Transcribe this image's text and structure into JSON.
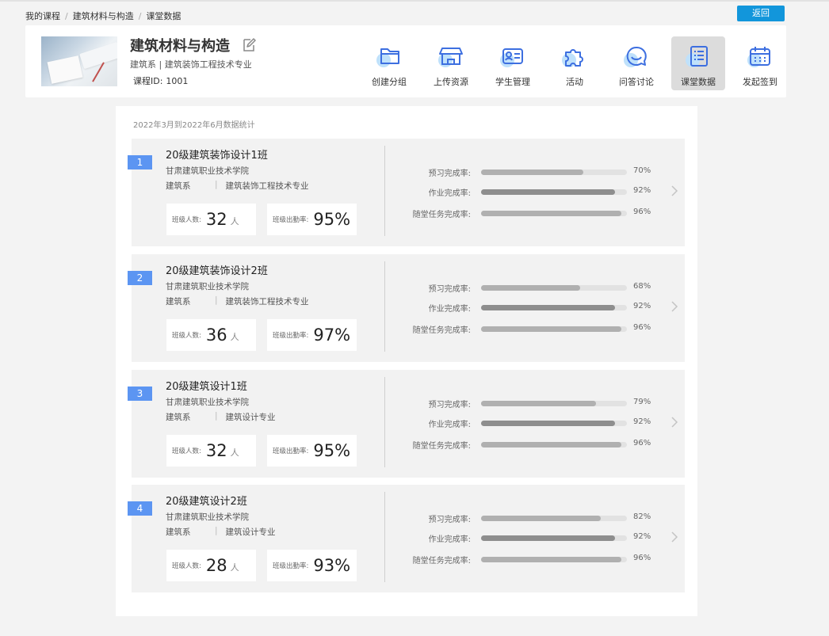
{
  "breadcrumb": {
    "items": [
      "我的课程",
      "建筑材料与构造",
      "课堂数据"
    ],
    "separator": "/"
  },
  "back_button": "返回",
  "course": {
    "title": "建筑材料与构造",
    "dept": "建筑系 | 建筑装饰工程技术专业",
    "id_label": "课程ID:",
    "id_value": "1001"
  },
  "toolbar": {
    "items": [
      {
        "label": "创建分组",
        "icon": "folder-icon"
      },
      {
        "label": "上传资源",
        "icon": "store-icon"
      },
      {
        "label": "学生管理",
        "icon": "id-card-icon"
      },
      {
        "label": "活动",
        "icon": "puzzle-icon"
      },
      {
        "label": "问答讨论",
        "icon": "chat-icon"
      },
      {
        "label": "课堂数据",
        "icon": "document-list-icon",
        "active": true
      },
      {
        "label": "发起签到",
        "icon": "calendar-icon"
      }
    ]
  },
  "period": "2022年3月到2022年6月数据统计",
  "labels": {
    "count": "班级人数:",
    "count_unit": "人",
    "attendance": "班级出勤率:",
    "preview": "预习完成率:",
    "homework": "作业完成率:",
    "task": "随堂任务完成率:"
  },
  "classes": [
    {
      "num": "1",
      "name": "20级建筑装饰设计1班",
      "school": "甘肃建筑职业技术学院",
      "dept": "建筑系",
      "major": "建筑装饰工程技术专业",
      "count": "32",
      "attendance": "95%",
      "preview": "70%",
      "homework": "92%",
      "task": "96%"
    },
    {
      "num": "2",
      "name": "20级建筑装饰设计2班",
      "school": "甘肃建筑职业技术学院",
      "dept": "建筑系",
      "major": "建筑装饰工程技术专业",
      "count": "36",
      "attendance": "97%",
      "preview": "68%",
      "homework": "92%",
      "task": "96%"
    },
    {
      "num": "3",
      "name": "20级建筑设计1班",
      "school": "甘肃建筑职业技术学院",
      "dept": "建筑系",
      "major": "建筑设计专业",
      "count": "32",
      "attendance": "95%",
      "preview": "79%",
      "homework": "92%",
      "task": "96%"
    },
    {
      "num": "4",
      "name": "20级建筑设计2班",
      "school": "甘肃建筑职业技术学院",
      "dept": "建筑系",
      "major": "建筑设计专业",
      "count": "28",
      "attendance": "93%",
      "preview": "82%",
      "homework": "92%",
      "task": "96%"
    }
  ],
  "colors": {
    "accent": "#1296db",
    "badge": "#5c95f2",
    "icon_blue": "#3d6fe0",
    "icon_bubble": "#bfe1fb"
  }
}
